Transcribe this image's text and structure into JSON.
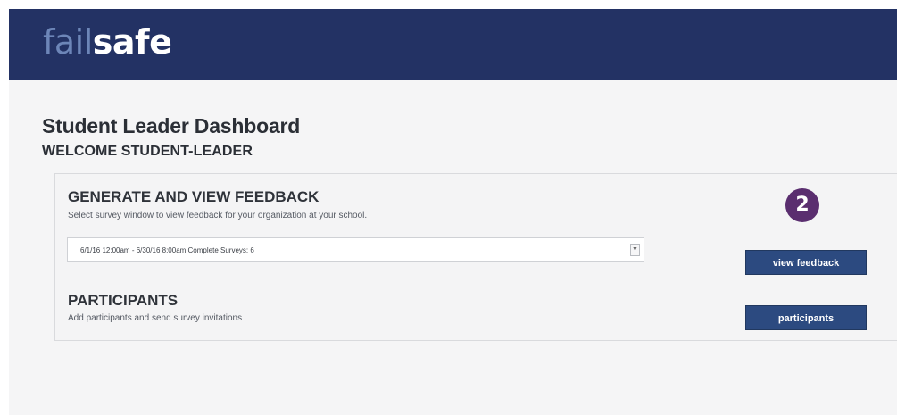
{
  "logo": {
    "part1": "fail",
    "part2": "safe"
  },
  "page": {
    "title": "Student Leader Dashboard",
    "welcome": "WELCOME STUDENT-LEADER"
  },
  "feedback": {
    "title": "GENERATE AND VIEW FEEDBACK",
    "description": "Select survey window to view feedback for your organization at your school.",
    "survey_window": {
      "selected": "6/1/16 12:00am - 6/30/16 8:00am Complete Surveys: 6"
    },
    "button_label": "view feedback"
  },
  "participants": {
    "title": "PARTICIPANTS",
    "description": "Add participants and send survey invitations",
    "button_label": "participants"
  },
  "step_badge": "2",
  "colors": {
    "header_bg": "#233264",
    "logo_fail": "#6d86b8",
    "button_bg": "#2c4a80",
    "badge_bg": "#5a2e6f"
  }
}
